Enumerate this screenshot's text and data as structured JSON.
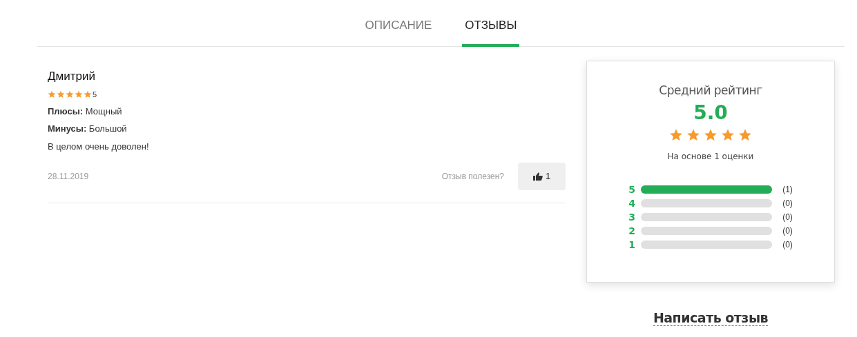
{
  "tabs": [
    {
      "label": "ОПИСАНИЕ",
      "selected": false
    },
    {
      "label": "ОТЗЫВЫ",
      "selected": true
    }
  ],
  "reviews": [
    {
      "author": "Дмитрий",
      "stars": 5,
      "rating": "5",
      "pros": "**Плюсы:** Мощный",
      "cons": "**Минусы:** Большой",
      "comment": "В целом очень доволен!",
      "date": "28.11.2019",
      "helpful_prompt": "Отзыв полезен?",
      "likes": "1"
    }
  ],
  "summary": {
    "title": "Средний рейтинг",
    "average": "5.0",
    "stars": 5,
    "based_on": "На основе 1 оценки",
    "bars": [
      {
        "label": "5",
        "level": 1,
        "count": "(1)"
      },
      {
        "label": "4",
        "level": 0,
        "count": "(0)"
      },
      {
        "label": "3",
        "level": 0,
        "count": "(0)"
      },
      {
        "label": "2",
        "level": 0,
        "count": "(0)"
      },
      {
        "label": "1",
        "level": 0,
        "count": "(0)"
      }
    ]
  },
  "write_review": "Написать отзыв"
}
